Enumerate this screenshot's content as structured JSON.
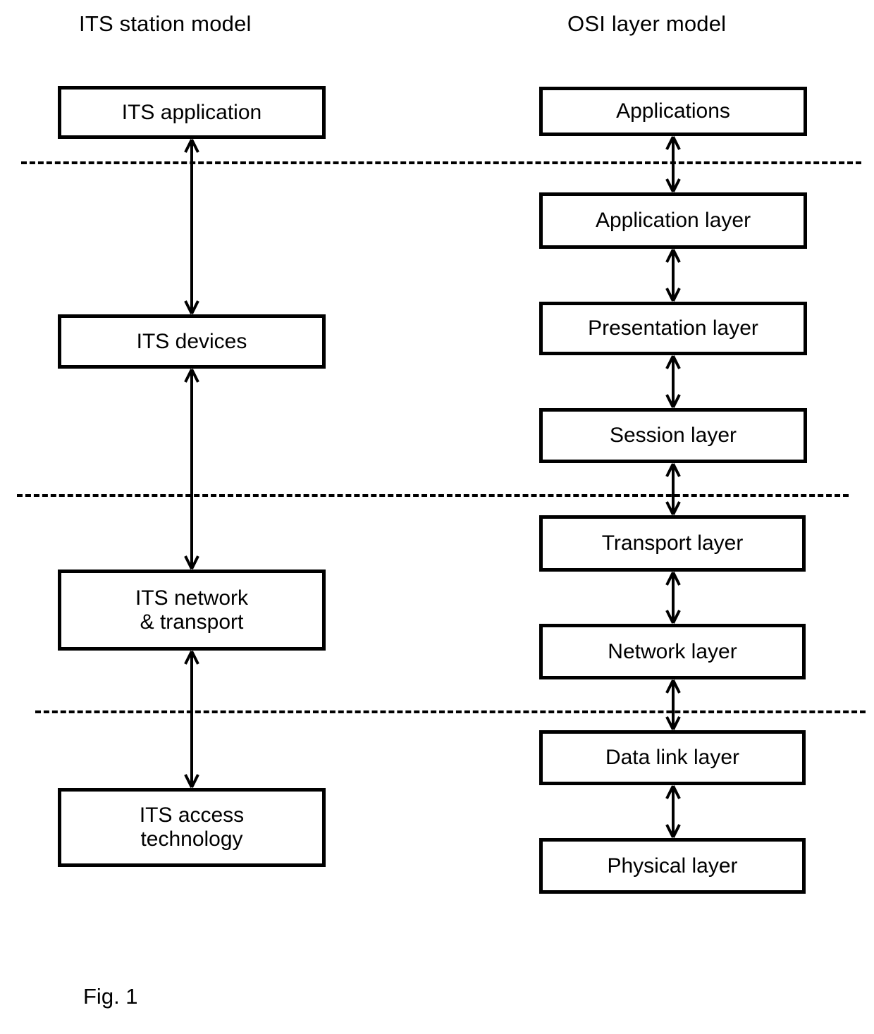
{
  "figure": {
    "caption": "Fig. 1"
  },
  "columns": [
    {
      "id": "its-station-model",
      "title": "ITS station model",
      "nodes": [
        {
          "id": "its-application",
          "label": "ITS application",
          "lines": [
            "ITS application"
          ]
        },
        {
          "id": "its-devices",
          "label": "ITS devices",
          "lines": [
            "ITS devices"
          ]
        },
        {
          "id": "its-network",
          "label": "ITS network & transport",
          "lines": [
            "ITS network",
            "& transport"
          ]
        },
        {
          "id": "its-access",
          "label": "ITS access technology",
          "lines": [
            "ITS access",
            "technology"
          ]
        }
      ],
      "connectors": [
        {
          "from": "its-application",
          "to": "its-devices",
          "style": "double-headed-arrow"
        },
        {
          "from": "its-devices",
          "to": "its-network",
          "style": "double-headed-arrow"
        },
        {
          "from": "its-network",
          "to": "its-access",
          "style": "double-headed-arrow"
        }
      ]
    },
    {
      "id": "osi-layer-model",
      "title": "OSI layer model",
      "nodes": [
        {
          "id": "applications",
          "label": "Applications",
          "lines": [
            "Applications"
          ]
        },
        {
          "id": "application-layer",
          "label": "Application layer",
          "lines": [
            "Application layer"
          ]
        },
        {
          "id": "presentation-layer",
          "label": "Presentation layer",
          "lines": [
            "Presentation layer"
          ]
        },
        {
          "id": "session-layer",
          "label": "Session layer",
          "lines": [
            "Session layer"
          ]
        },
        {
          "id": "transport-layer",
          "label": "Transport layer",
          "lines": [
            "Transport layer"
          ]
        },
        {
          "id": "network-layer",
          "label": "Network layer",
          "lines": [
            "Network layer"
          ]
        },
        {
          "id": "data-link-layer",
          "label": "Data link layer",
          "lines": [
            "Data link layer"
          ]
        },
        {
          "id": "physical-layer",
          "label": "Physical layer",
          "lines": [
            "Physical layer"
          ]
        }
      ],
      "connectors": [
        {
          "from": "applications",
          "to": "application-layer",
          "style": "double-headed-arrow"
        },
        {
          "from": "application-layer",
          "to": "presentation-layer",
          "style": "double-headed-arrow"
        },
        {
          "from": "presentation-layer",
          "to": "session-layer",
          "style": "double-headed-arrow"
        },
        {
          "from": "session-layer",
          "to": "transport-layer",
          "style": "double-headed-arrow"
        },
        {
          "from": "transport-layer",
          "to": "network-layer",
          "style": "double-headed-arrow"
        },
        {
          "from": "network-layer",
          "to": "data-link-layer",
          "style": "double-headed-arrow"
        },
        {
          "from": "data-link-layer",
          "to": "physical-layer",
          "style": "double-headed-arrow"
        }
      ]
    }
  ],
  "separators": [
    {
      "id": "separator-1",
      "style": "dashed",
      "splits_left": "ITS application / ITS devices",
      "splits_right": "Applications / Application layer"
    },
    {
      "id": "separator-2",
      "style": "dashed",
      "splits_left": "ITS devices / ITS network & transport",
      "splits_right": "Session layer / Transport layer"
    },
    {
      "id": "separator-3",
      "style": "dashed",
      "splits_left": "ITS network & transport / ITS access technology",
      "splits_right": "Network layer / Data link layer"
    }
  ],
  "colors": {
    "stroke": "#000000",
    "background": "#ffffff",
    "text": "#000000"
  }
}
